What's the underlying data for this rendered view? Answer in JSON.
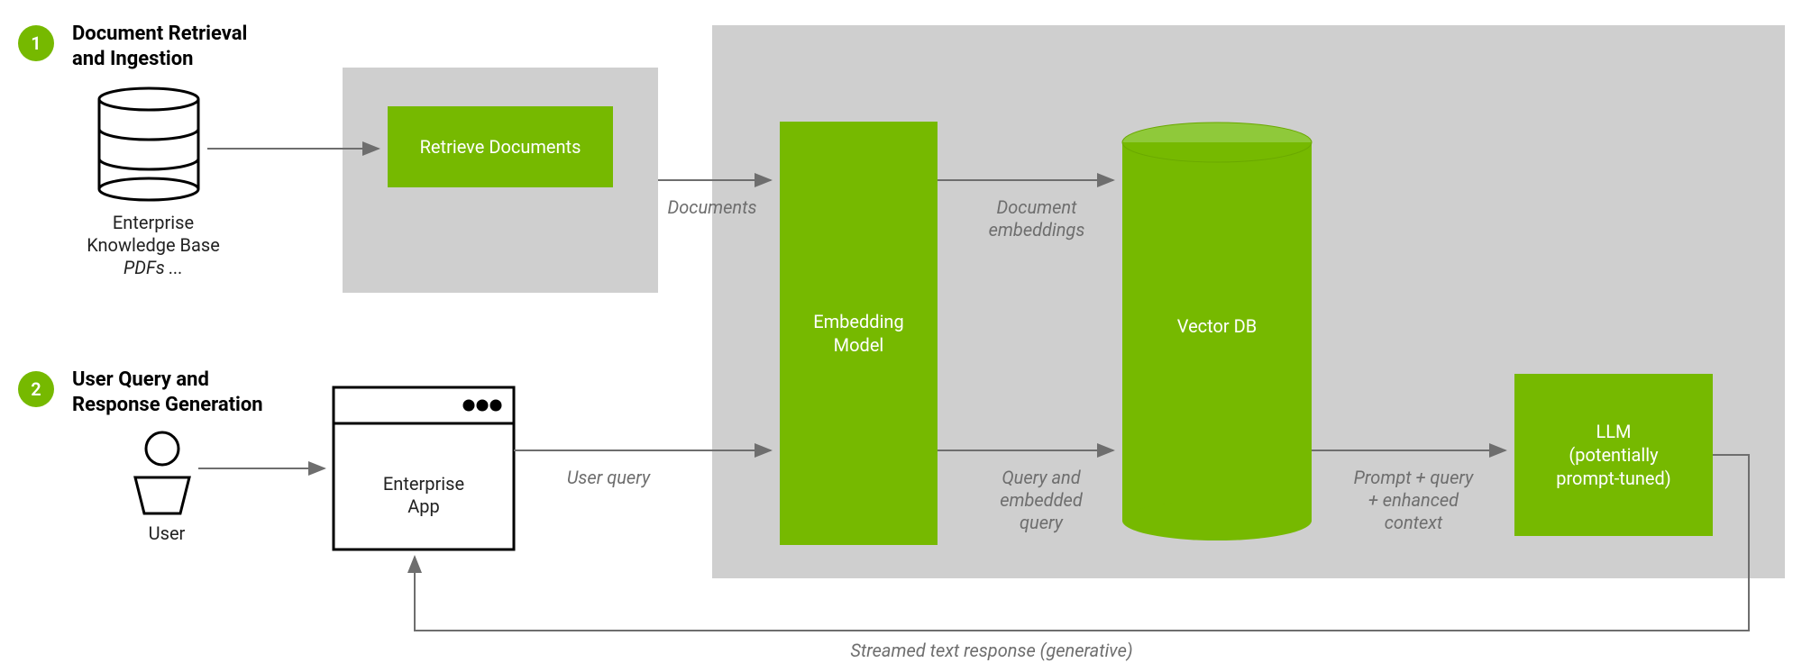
{
  "steps": {
    "one": {
      "number": "1",
      "title": "Document Retrieval\nand Ingestion"
    },
    "two": {
      "number": "2",
      "title": "User Query and\nResponse Generation"
    }
  },
  "nodes": {
    "knowledge_base": {
      "line1": "Enterprise",
      "line2": "Knowledge Base",
      "line3": "PDFs ..."
    },
    "user": {
      "label": "User"
    },
    "enterprise_app": {
      "label": "Enterprise\nApp"
    },
    "retrieve_documents": {
      "label": "Retrieve Documents"
    },
    "embedding_model": {
      "label": "Embedding\nModel"
    },
    "vector_db": {
      "label": "Vector DB"
    },
    "llm": {
      "label": "LLM\n(potentially\nprompt-tuned)"
    }
  },
  "edges": {
    "documents": "Documents",
    "document_embeddings": "Document\nembeddings",
    "user_query": "User query",
    "query_embedded": "Query and\nembedded\nquery",
    "prompt_context": "Prompt + query\n+ enhanced\ncontext",
    "streamed_response": "Streamed text response (generative)"
  }
}
